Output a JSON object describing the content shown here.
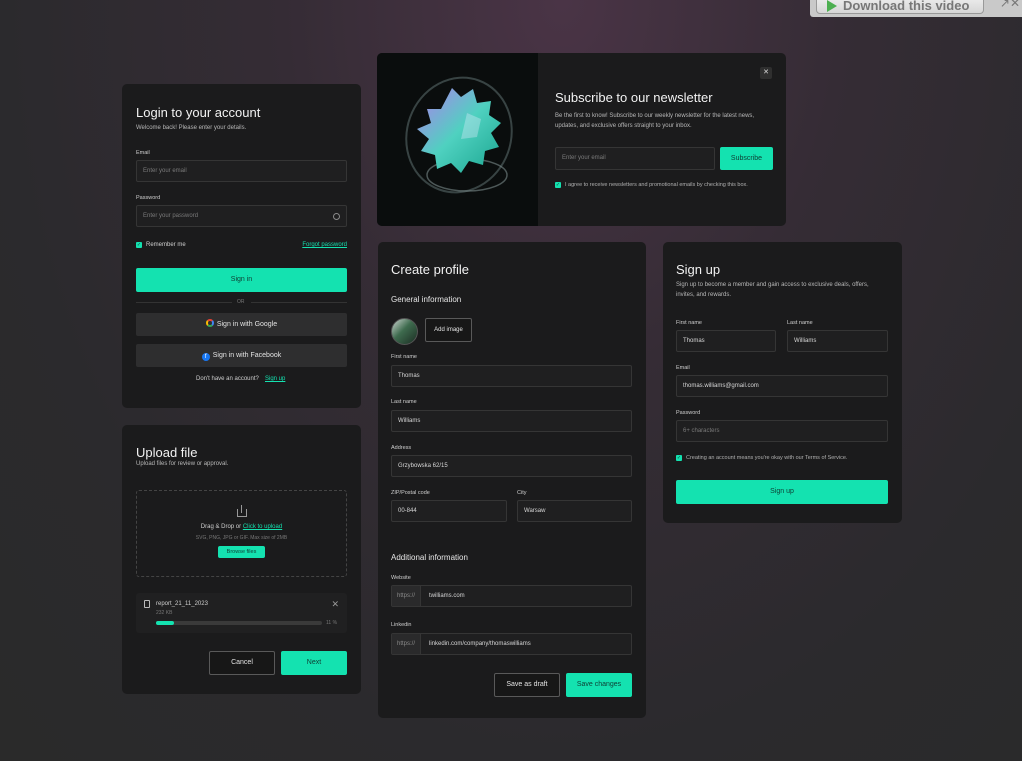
{
  "browser": {
    "download_label": "Download this video",
    "icons": "↗✕"
  },
  "login": {
    "title": "Login to your account",
    "subtitle": "Welcome back! Please enter your details.",
    "email_label": "Email",
    "email_placeholder": "Enter your email",
    "password_label": "Password",
    "password_placeholder": "Enter your password",
    "remember_label": "Remember me",
    "forgot_label": "Forgot password",
    "sign_in_label": "Sign in",
    "or_label": "OR",
    "google_label": "Sign in with Google",
    "facebook_label": "Sign in with Facebook",
    "no_account_text": "Don't have an account?",
    "sign_up_link": "Sign up"
  },
  "newsletter": {
    "title": "Subscribe to our newsletter",
    "description": "Be the first to know! Subscribe to our weekly newsletter for the latest news, updates, and exclusive offers straight to your inbox.",
    "email_placeholder": "Enter your email",
    "subscribe_label": "Subscribe",
    "agree_text": "I agree to receive newsletters and promotional emails by checking this box.",
    "close_icon": "✕"
  },
  "upload": {
    "title": "Upload file",
    "subtitle": "Upload files for review or approval.",
    "drop_text": "Drag & Drop or",
    "drop_link": "Click to upload",
    "formats": "SVG, PNG, JPG or GIF. Max size of 2MB",
    "browse_label": "Browse files",
    "file_name": "report_21_11_2023",
    "file_size": "232 KB",
    "progress_text": "11 %",
    "progress": 0.11,
    "cancel_label": "Cancel",
    "next_label": "Next"
  },
  "profile": {
    "title": "Create profile",
    "general_heading": "General information",
    "add_image_label": "Add image",
    "first_name_label": "First name",
    "first_name_value": "Thomas",
    "last_name_label": "Last name",
    "last_name_value": "Williams",
    "address_label": "Address",
    "address_value": "Grzybowska 62/15",
    "zip_label": "ZIP/Postal code",
    "zip_value": "00-844",
    "city_label": "City",
    "city_value": "Warsaw",
    "additional_heading": "Additional information",
    "website_label": "Website",
    "website_prefix": "https://",
    "website_value": "twilliams.com",
    "linkedin_label": "Linkedin",
    "linkedin_prefix": "https://",
    "linkedin_value": "linkedin.com/company/thomaswilliams",
    "draft_label": "Save as draft",
    "save_label": "Save changes"
  },
  "signup": {
    "title": "Sign up",
    "subtitle": "Sign up to become a member and gain access to exclusive deals, offers, invites, and rewards.",
    "first_name_label": "First name",
    "first_name_value": "Thomas",
    "last_name_label": "Last name",
    "last_name_value": "Williams",
    "email_label": "Email",
    "email_value": "thomas.williams@gmail.com",
    "password_label": "Password",
    "password_placeholder": "6+ characters",
    "terms_text": "Creating an account means you're okay with our Terms of Service.",
    "submit_label": "Sign up"
  },
  "colors": {
    "accent": "#14e2b0",
    "card": "#1b1b1c"
  }
}
